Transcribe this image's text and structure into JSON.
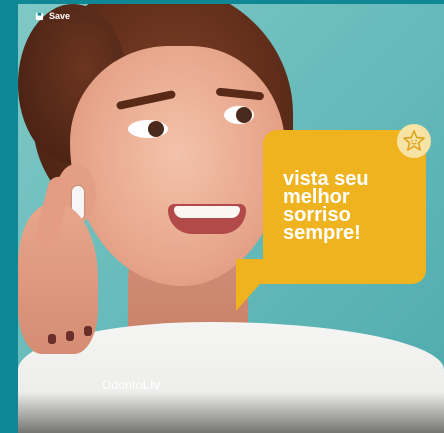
{
  "actions": {
    "save_label": "Save"
  },
  "post": {
    "headline": "vista seu\nmelhor\nsorriso\nsempre!",
    "brand_light": "Odonto",
    "brand_bold": "Liv"
  },
  "colors": {
    "frame": "#0f8795",
    "background": "#6cbcbc",
    "bubble": "#f0b320",
    "text": "#ffffff"
  },
  "icons": {
    "save": "bookmark-icon",
    "badge": "star-smile-icon"
  }
}
